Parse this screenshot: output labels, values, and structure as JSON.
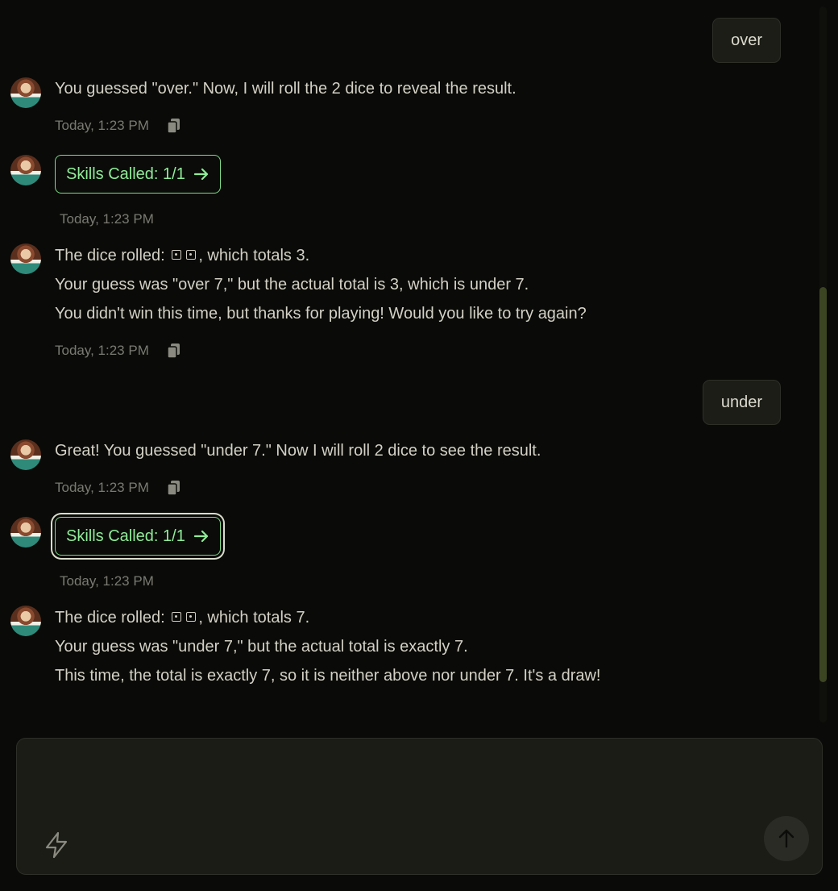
{
  "messages": {
    "user1": "over",
    "bot1": "You guessed \"over.\" Now, I will roll the 2 dice to reveal the result.",
    "time": "Today, 1:23 PM",
    "skills_label": "Skills Called: 1/1",
    "bot3_line1_pre": "The dice rolled:",
    "bot3_line1_post": ", which totals 3.",
    "bot3_line2": "Your guess was \"over 7,\" but the actual total is 3, which is under 7.",
    "bot3_line3": "You didn't win this time, but thanks for playing! Would you like to try again?",
    "user2": "under",
    "bot4": "Great! You guessed \"under 7.\" Now I will roll 2 dice to see the result.",
    "bot6_line1_pre": "The dice rolled:",
    "bot6_line1_post": ", which totals 7.",
    "bot6_line2": "Your guess was \"under 7,\" but the actual total is exactly 7.",
    "bot6_line3": "This time, the total is exactly 7, so it is neither above nor under 7. It's a draw!"
  },
  "composer": {
    "placeholder": ""
  },
  "icons": {
    "avatar": "avatar-icon",
    "copy": "copy-icon",
    "arrow": "arrow-right-icon",
    "bolt": "lightning-bolt-icon",
    "send": "arrow-up-icon",
    "die": "dice-icon"
  },
  "colors": {
    "background": "#0a0a08",
    "accent_green": "#8fec98",
    "bubble": "#1c1d17",
    "scroll_thumb": "#3c4522"
  }
}
